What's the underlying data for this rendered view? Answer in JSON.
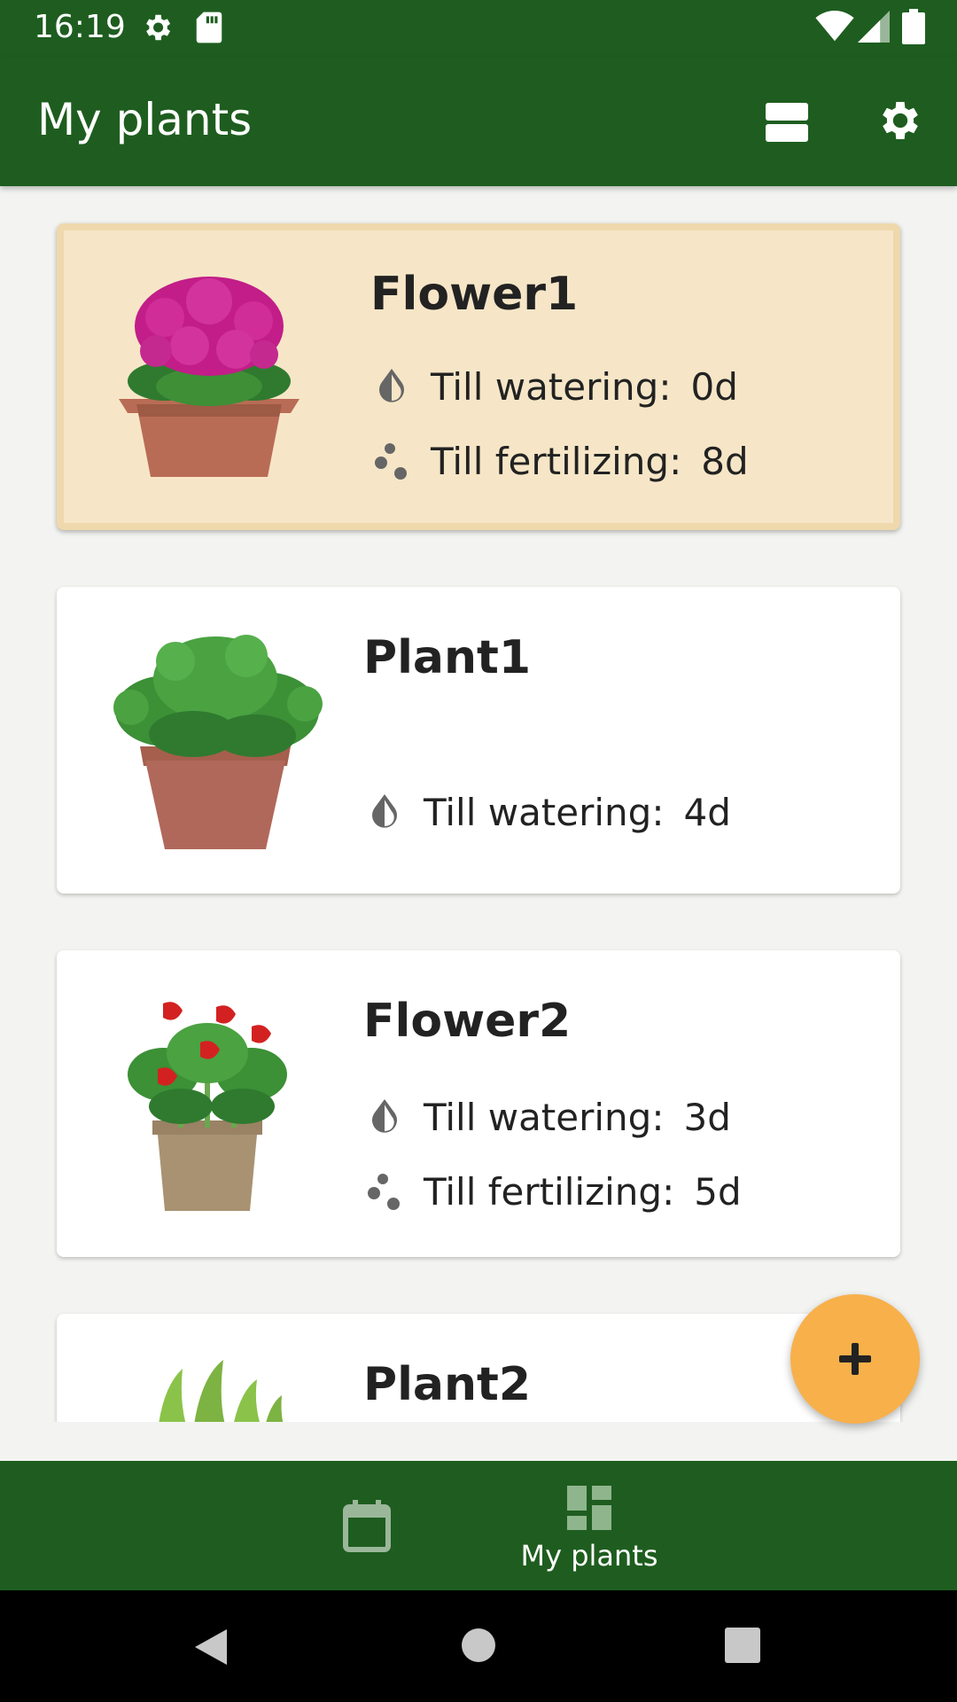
{
  "status_bar": {
    "time": "16:19"
  },
  "app_bar": {
    "title": "My plants"
  },
  "plants": [
    {
      "name": "Flower1",
      "highlighted": true,
      "watering_label": "Till watering:",
      "watering_value": "0d",
      "fertilizing_label": "Till fertilizing:",
      "fertilizing_value": "8d"
    },
    {
      "name": "Plant1",
      "highlighted": false,
      "watering_label": "Till watering:",
      "watering_value": "4d"
    },
    {
      "name": "Flower2",
      "highlighted": false,
      "watering_label": "Till watering:",
      "watering_value": "3d",
      "fertilizing_label": "Till fertilizing:",
      "fertilizing_value": "5d"
    },
    {
      "name": "Plant2",
      "highlighted": false
    }
  ],
  "bottom_nav": {
    "plants_label": "My plants"
  },
  "colors": {
    "primary": "#1e5d1f",
    "highlight_card": "#f6e6c7",
    "fab": "#f8b04a"
  },
  "icons": [
    "gear-icon",
    "sd-card-icon",
    "wifi-icon",
    "signal-icon",
    "battery-icon",
    "view-toggle-icon",
    "settings-icon",
    "water-drop-icon",
    "fertilizer-icon",
    "plus-icon",
    "calendar-icon",
    "dashboard-icon",
    "back-icon",
    "home-icon",
    "recents-icon"
  ]
}
